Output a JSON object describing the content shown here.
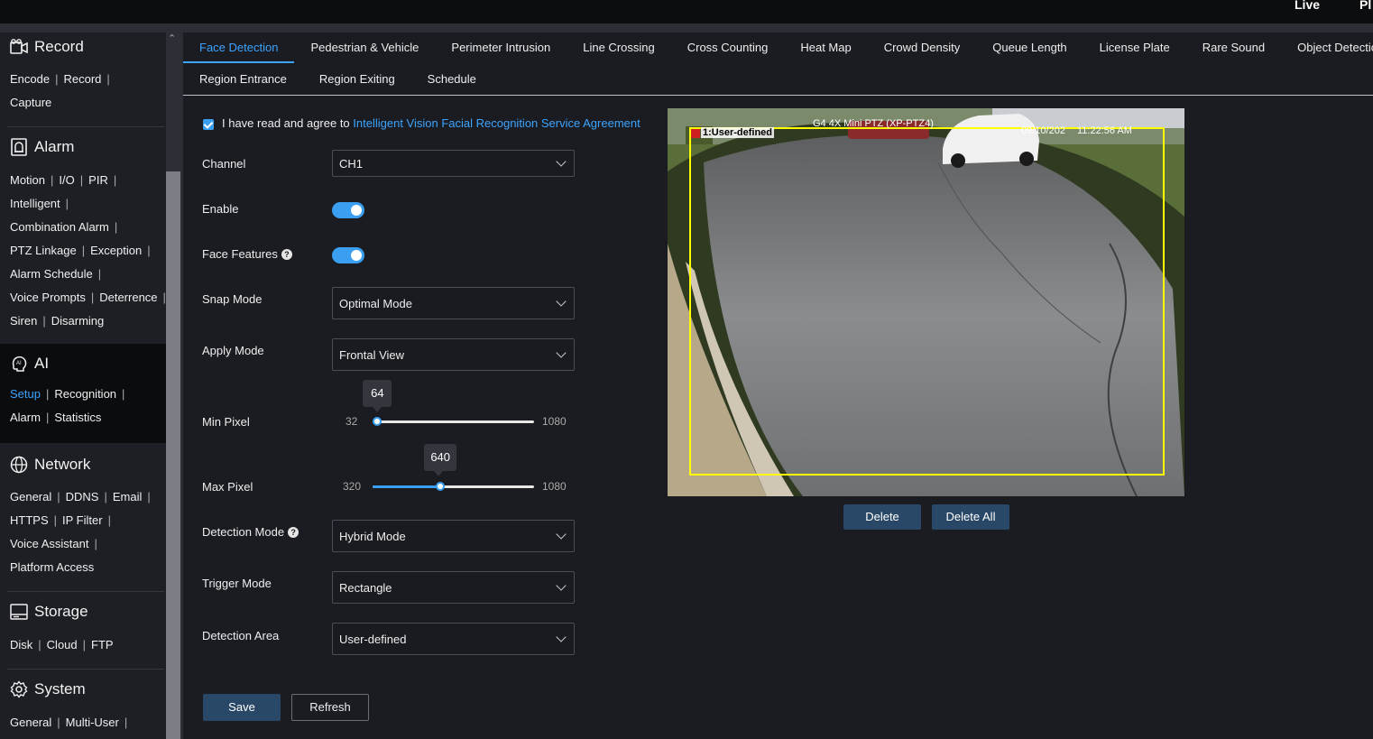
{
  "topbar": {
    "live": "Live",
    "pl": "Pl"
  },
  "sidebar": {
    "record": {
      "title": "Record",
      "lines": [
        [
          "Encode",
          "Record"
        ],
        [
          "Capture"
        ]
      ]
    },
    "alarm": {
      "title": "Alarm",
      "lines": [
        [
          "Motion",
          "I/O",
          "PIR"
        ],
        [
          "Intelligent"
        ],
        [
          "Combination Alarm"
        ],
        [
          "PTZ Linkage",
          "Exception"
        ],
        [
          "Alarm Schedule"
        ],
        [
          "Voice Prompts",
          "Deterrence"
        ],
        [
          "Siren",
          "Disarming"
        ]
      ]
    },
    "ai": {
      "title": "AI",
      "lines": [
        [
          "Setup",
          "Recognition"
        ],
        [
          "Alarm",
          "Statistics"
        ]
      ]
    },
    "network": {
      "title": "Network",
      "lines": [
        [
          "General",
          "DDNS",
          "Email"
        ],
        [
          "HTTPS",
          "IP Filter"
        ],
        [
          "Voice Assistant"
        ],
        [
          "Platform Access"
        ]
      ]
    },
    "storage": {
      "title": "Storage",
      "lines": [
        [
          "Disk",
          "Cloud",
          "FTP"
        ]
      ]
    },
    "system": {
      "title": "System",
      "lines": [
        [
          "General",
          "Multi-User"
        ]
      ]
    }
  },
  "tabs": {
    "row1": [
      "Face Detection",
      "Pedestrian & Vehicle",
      "Perimeter Intrusion",
      "Line Crossing",
      "Cross Counting",
      "Heat Map",
      "Crowd Density",
      "Queue Length",
      "License Plate",
      "Rare Sound",
      "Object Detection"
    ],
    "row2": [
      "Region Entrance",
      "Region Exiting",
      "Schedule"
    ]
  },
  "agreement": {
    "text": "I have read and agree to ",
    "link": "Intelligent Vision Facial Recognition Service Agreement"
  },
  "form": {
    "channel": {
      "label": "Channel",
      "value": "CH1"
    },
    "enable": {
      "label": "Enable",
      "on": true
    },
    "face_features": {
      "label": "Face Features",
      "on": true
    },
    "snap_mode": {
      "label": "Snap Mode",
      "value": "Optimal Mode"
    },
    "apply_mode": {
      "label": "Apply Mode",
      "value": "Frontal View"
    },
    "min_pixel": {
      "label": "Min Pixel",
      "min": "32",
      "max": "1080",
      "value": "64",
      "fraction": 0.03
    },
    "max_pixel": {
      "label": "Max Pixel",
      "min": "320",
      "max": "1080",
      "value": "640",
      "fraction": 0.42
    },
    "detection_mode": {
      "label": "Detection Mode",
      "value": "Hybrid Mode"
    },
    "trigger_mode": {
      "label": "Trigger Mode",
      "value": "Rectangle"
    },
    "detection_area": {
      "label": "Detection Area",
      "value": "User-defined"
    }
  },
  "buttons": {
    "save": "Save",
    "refresh": "Refresh",
    "delete": "Delete",
    "delete_all": "Delete All"
  },
  "preview": {
    "camera_name": "G4 4X Mini PTZ (XP-PTZ4)",
    "date": "09/10/202",
    "time": "11:22:56 AM",
    "region_tag": "1:User-defined"
  },
  "colors": {
    "accent": "#3ba4ff",
    "region": "#ffff00"
  }
}
